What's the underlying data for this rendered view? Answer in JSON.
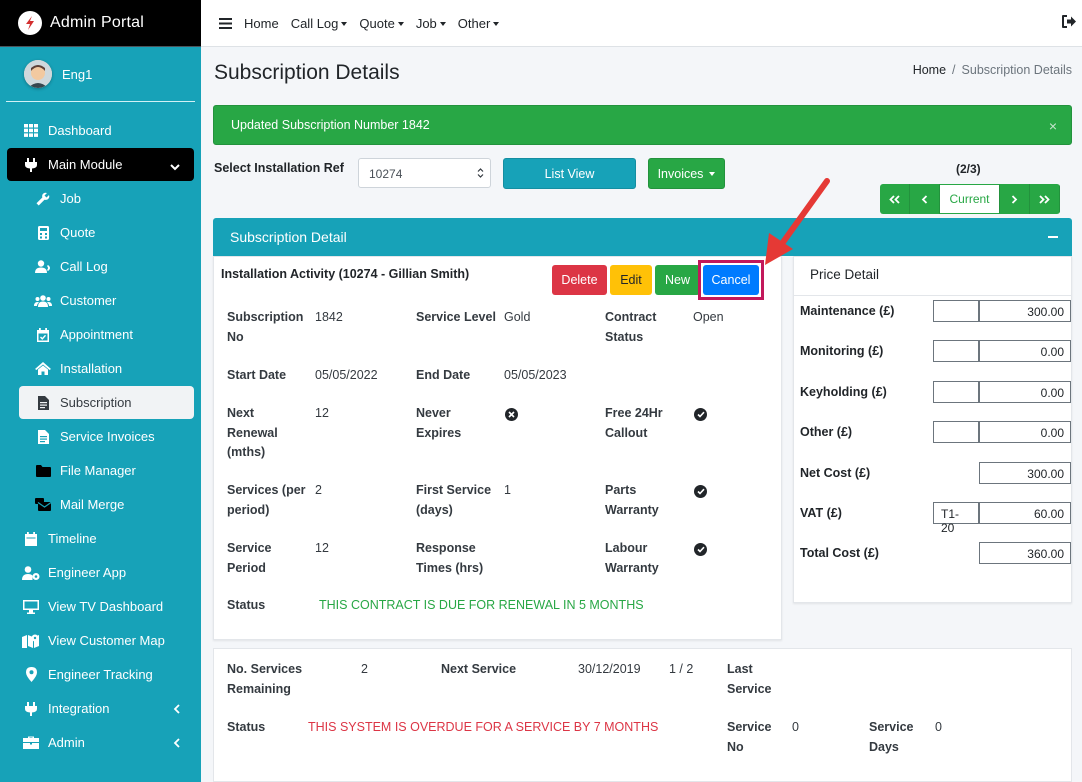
{
  "app": {
    "title": "Admin Portal"
  },
  "user": {
    "name": "Eng1"
  },
  "sidebar": {
    "items": [
      {
        "label": "Dashboard",
        "icon": "grid-icon"
      },
      {
        "label": "Main Module",
        "icon": "plug-icon"
      },
      {
        "label": "Job",
        "icon": "wrench-icon"
      },
      {
        "label": "Quote",
        "icon": "calculator-icon"
      },
      {
        "label": "Call Log",
        "icon": "user-phone-icon"
      },
      {
        "label": "Customer",
        "icon": "users-icon"
      },
      {
        "label": "Appointment",
        "icon": "calendar-icon"
      },
      {
        "label": "Installation",
        "icon": "home-icon"
      },
      {
        "label": "Subscription",
        "icon": "file-icon"
      },
      {
        "label": "Service Invoices",
        "icon": "file-lines-icon"
      },
      {
        "label": "File Manager",
        "icon": "folder-icon"
      },
      {
        "label": "Mail Merge",
        "icon": "mail-merge-icon"
      },
      {
        "label": "Timeline",
        "icon": "calendar-icon"
      },
      {
        "label": "Engineer App",
        "icon": "user-cog-icon"
      },
      {
        "label": "View TV Dashboard",
        "icon": "monitor-icon"
      },
      {
        "label": "View Customer Map",
        "icon": "map-icon"
      },
      {
        "label": "Engineer Tracking",
        "icon": "map-marker-icon"
      },
      {
        "label": "Integration",
        "icon": "plug-icon"
      },
      {
        "label": "Admin",
        "icon": "briefcase-icon"
      }
    ]
  },
  "topnav": {
    "home": "Home",
    "call_log": "Call Log",
    "quote": "Quote",
    "job": "Job",
    "other": "Other"
  },
  "page": {
    "title": "Subscription Details"
  },
  "breadcrumb": {
    "home": "Home",
    "sep": "/",
    "current": "Subscription Details"
  },
  "alert": {
    "text": "Updated Subscription Number 1842",
    "close": "×"
  },
  "selector": {
    "label": "Select Installation Ref",
    "value": "10274"
  },
  "buttons": {
    "list_view": "List View",
    "invoices": "Invoices"
  },
  "pager": {
    "count": "(2/3)",
    "current": "Current"
  },
  "card": {
    "title": "Subscription Detail"
  },
  "activity": {
    "title": "Installation Activity (10274 - Gillian Smith)"
  },
  "actions": {
    "delete": "Delete",
    "edit": "Edit",
    "new": "New",
    "cancel": "Cancel"
  },
  "fields": {
    "sub_no_l1": "Subscription",
    "sub_no_l2": "No",
    "sub_no": "1842",
    "service_level_l": "Service Level",
    "service_level": "Gold",
    "contract_l1": "Contract",
    "contract_l2": "Status",
    "contract": "Open",
    "start_l": "Start Date",
    "start": "05/05/2022",
    "end_l": "End Date",
    "end": "05/05/2023",
    "renewal_l1": "Next",
    "renewal_l2": "Renewal",
    "renewal_l3": "(mths)",
    "renewal": "12",
    "never_l1": "Never",
    "never_l2": "Expires",
    "free_l1": "Free 24Hr",
    "free_l2": "Callout",
    "services_l1": "Services (per",
    "services_l2": "period)",
    "services": "2",
    "first_l1": "First Service",
    "first_l2": "(days)",
    "first": "1",
    "parts_l1": "Parts",
    "parts_l2": "Warranty",
    "period_l1": "Service",
    "period_l2": "Period",
    "period": "12",
    "response_l1": "Response",
    "response_l2": "Times (hrs)",
    "labour_l1": "Labour",
    "labour_l2": "Warranty",
    "status_l": "Status",
    "status": "THIS CONTRACT IS DUE FOR RENEWAL IN 5 MONTHS"
  },
  "price": {
    "title": "Price Detail",
    "maintenance_l": "Maintenance (£)",
    "maintenance": "300.00",
    "monitoring_l": "Monitoring (£)",
    "monitoring": "0.00",
    "keyholding_l": "Keyholding (£)",
    "keyholding": "0.00",
    "other_l": "Other (£)",
    "other": "0.00",
    "net_l": "Net Cost (£)",
    "net": "300.00",
    "vat_l": "VAT (£)",
    "vat_code": "T1-20",
    "vat": "60.00",
    "total_l": "Total Cost (£)",
    "total": "360.00"
  },
  "service_info": {
    "remaining_l1": "No. Services",
    "remaining_l2": "Remaining",
    "remaining": "2",
    "next_l": "Next Service",
    "next": "30/12/2019",
    "ratio": "1 / 2",
    "last_l1": "Last",
    "last_l2": "Service",
    "status_l": "Status",
    "status": "THIS SYSTEM IS OVERDUE FOR A SERVICE BY 7 MONTHS",
    "service_no_l1": "Service",
    "service_no_l2": "No",
    "service_no": "0",
    "service_days_l1": "Service",
    "service_days_l2": "Days",
    "service_days": "0"
  },
  "colors": {
    "sidebar": "#17a2b8",
    "success": "#28a745",
    "danger": "#dc3545",
    "warning": "#ffc107",
    "primary": "#007bff",
    "highlight": "#c2185b",
    "annotation_arrow": "#e53935"
  }
}
